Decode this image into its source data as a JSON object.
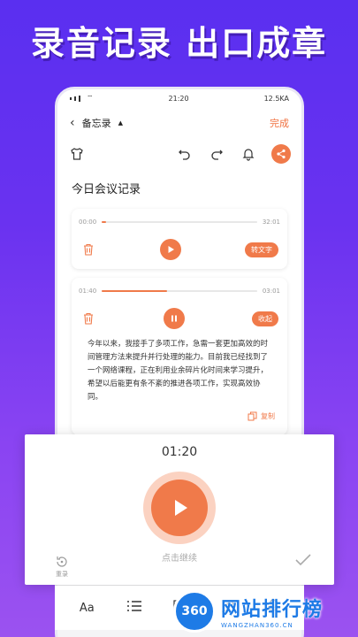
{
  "banner": {
    "title": "录音记录 出口成章"
  },
  "status": {
    "time": "21:20",
    "right": "12.5KA"
  },
  "nav": {
    "title": "备忘录",
    "done": "完成"
  },
  "note": {
    "title": "今日会议记录"
  },
  "recordings": [
    {
      "start": "00:00",
      "end": "32:01",
      "progress": 0.03,
      "action": "转文字",
      "state": "paused"
    },
    {
      "start": "01:40",
      "end": "03:01",
      "progress": 0.42,
      "action": "收起",
      "state": "playing"
    }
  ],
  "transcript": "今年以来，我接手了多项工作，急需一套更加高效的时间管理方法来提升并行处理的能力。目前我已经找到了一个网络课程，正在利用业余碎片化时间来学习提升，希望以后能更有条不紊的推进各项工作，实现高效协同。",
  "copy_label": "复制",
  "recorder": {
    "time": "01:20",
    "hint": "点击继续",
    "rerecord": "重录"
  },
  "bottom_bar": {
    "font_label": "Aa"
  },
  "watermark": {
    "logo": "360",
    "cn": "网站排行榜",
    "en": "WANGZHAN360.CN"
  },
  "colors": {
    "accent": "#f07a4a",
    "bg_top": "#5a2ff0",
    "bg_bottom": "#9b52f0"
  }
}
